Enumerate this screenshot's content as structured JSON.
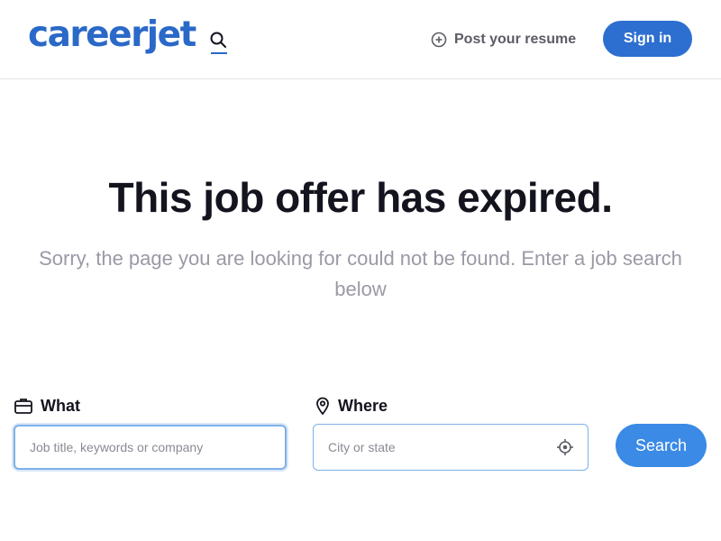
{
  "header": {
    "logo_text": "careerjet",
    "post_resume_label": "Post your resume",
    "sign_in_label": "Sign in"
  },
  "hero": {
    "title": "This job offer has expired.",
    "subtitle": "Sorry, the page you are looking for could not be found. Enter a job search below"
  },
  "search": {
    "what_label": "What",
    "what_placeholder": "Job title, keywords or company",
    "where_label": "Where",
    "where_placeholder": "City or state",
    "button_label": "Search"
  },
  "colors": {
    "brand": "#2a69c8",
    "sign_in_bg": "#2d6fd0",
    "search_button_bg": "#3b8ae6",
    "input_border": "#7fb0e8",
    "muted_text": "#9a9aa6"
  }
}
